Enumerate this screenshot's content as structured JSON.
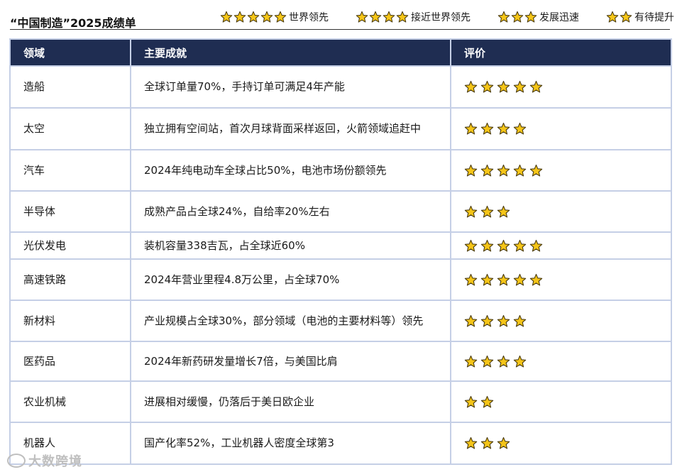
{
  "title": "“中国制造”2025成绩单",
  "legend": [
    {
      "stars": 5,
      "label": "世界领先"
    },
    {
      "stars": 4,
      "label": "接近世界领先"
    },
    {
      "stars": 3,
      "label": "发展迅速"
    },
    {
      "stars": 2,
      "label": "有待提升"
    }
  ],
  "star_color": "#f5c518",
  "table": {
    "headers": [
      "领域",
      "主要成就",
      "评价"
    ],
    "header_bg": "#1f2d52",
    "rows": [
      {
        "field": "造船",
        "achievement": "全球订单量70%，手持订单可满足4年产能",
        "rating": 5
      },
      {
        "field": "太空",
        "achievement": "独立拥有空间站，首次月球背面采样返回，火箭领域追赶中",
        "rating": 4
      },
      {
        "field": "汽车",
        "achievement": "2024年纯电动车全球占比50%，电池市场份额领先",
        "rating": 5
      },
      {
        "field": "半导体",
        "achievement": "成熟产品占全球24%，自给率20%左右",
        "rating": 3
      },
      {
        "field": "光伏发电",
        "achievement": "装机容量338吉瓦，占全球近60%",
        "rating": 5
      },
      {
        "field": "高速铁路",
        "achievement": "2024年营业里程4.8万公里，占全球70%",
        "rating": 5
      },
      {
        "field": "新材料",
        "achievement": "产业规模占全球30%，部分领域（电池的主要材料等）领先",
        "rating": 4
      },
      {
        "field": "医药品",
        "achievement": "2024年新药研发量增长7倍，与美国比肩",
        "rating": 4
      },
      {
        "field": "农业机械",
        "achievement": "进展相对缓慢，仍落后于美日欧企业",
        "rating": 2
      },
      {
        "field": "机器人",
        "achievement": "国产化率52%，工业机器人密度全球第3",
        "rating": 3
      }
    ]
  },
  "watermark": "大数跨境"
}
